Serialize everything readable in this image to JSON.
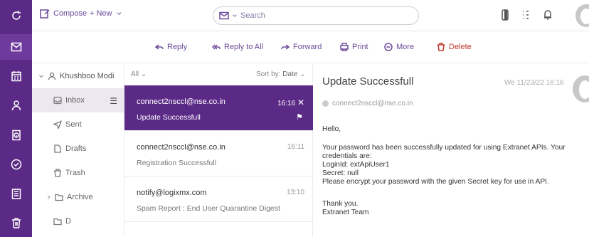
{
  "topbar": {
    "compose_label": "Compose",
    "new_label": "+ New",
    "search_placeholder": "Search"
  },
  "actions": {
    "reply": "Reply",
    "reply_all": "Reply to All",
    "forward": "Forward",
    "print": "Print",
    "more": "More",
    "delete": "Delete"
  },
  "account": {
    "name": "Khushboo Modi"
  },
  "folders": [
    {
      "label": "Inbox"
    },
    {
      "label": "Sent"
    },
    {
      "label": "Drafts"
    },
    {
      "label": "Trash"
    },
    {
      "label": "Archive"
    },
    {
      "label": "D"
    }
  ],
  "list_header": {
    "filter": "All",
    "sort_prefix": "Sort by:",
    "sort_value": "Date"
  },
  "messages": [
    {
      "from": "connect2nsccl@nse.co.in",
      "subject": "Update Successfull",
      "time": "16:16",
      "selected": true
    },
    {
      "from": "connect2nsccl@nse.co.in",
      "subject": "Registration Successfull",
      "time": "16:11",
      "selected": false
    },
    {
      "from": "notify@logixmx.com",
      "subject": "Spam Report : End User Quarantine Digest",
      "time": "13:10",
      "selected": false
    }
  ],
  "reading": {
    "title": "Update Successfull",
    "date": "We 11/23/22 16:16",
    "from": "connect2nsccl@nse.co.in",
    "greeting": "Hello,",
    "line1": "Your password has been successfully updated for using Extranet APIs. Your credentials are:",
    "line2": "LoginId: extApiUser1",
    "line3": "Secret: null",
    "line4": "Please encrypt your password with the given Secret key for use in API.",
    "signoff1": "Thank you.",
    "signoff2": "Extranet Team"
  },
  "colors": {
    "brand": "#5b2a86",
    "accent": "#6a4a9a",
    "delete": "#c0392b"
  }
}
